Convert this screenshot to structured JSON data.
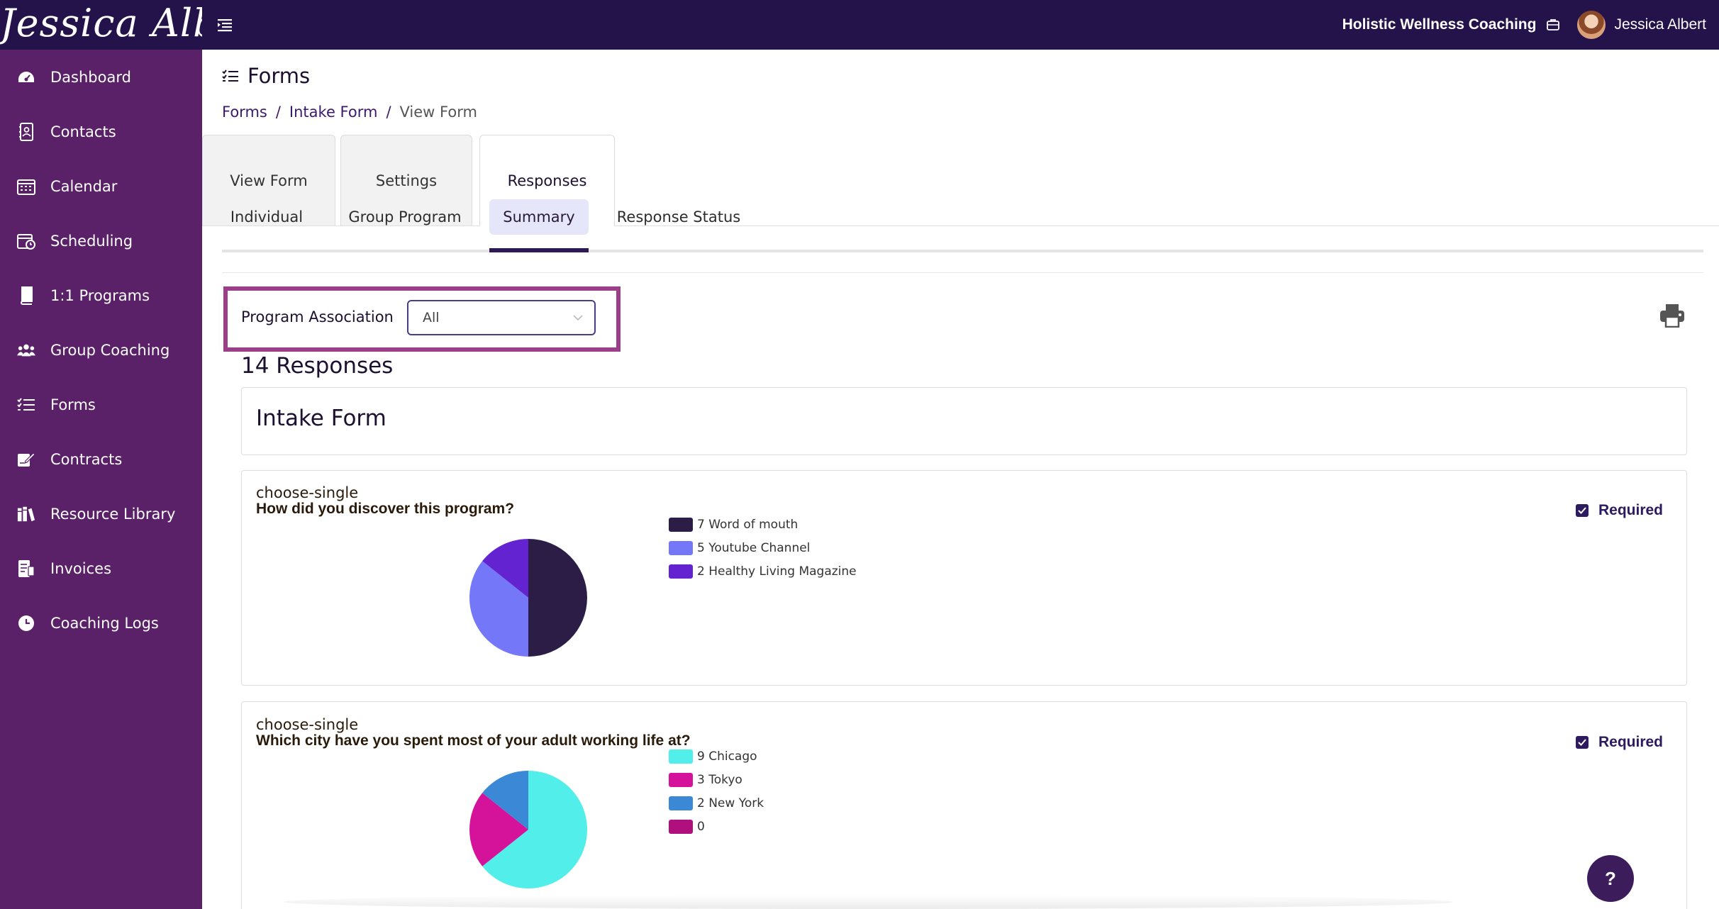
{
  "topbar": {
    "logo_text": "Jessica Albert",
    "business_name": "Holistic Wellness Coaching",
    "user_name": "Jessica Albert"
  },
  "sidebar": {
    "items": [
      {
        "label": "Dashboard",
        "icon": "dashboard-icon"
      },
      {
        "label": "Contacts",
        "icon": "contacts-icon"
      },
      {
        "label": "Calendar",
        "icon": "calendar-icon"
      },
      {
        "label": "Scheduling",
        "icon": "scheduling-icon"
      },
      {
        "label": "1:1 Programs",
        "icon": "book-icon"
      },
      {
        "label": "Group Coaching",
        "icon": "group-icon"
      },
      {
        "label": "Forms",
        "icon": "forms-icon"
      },
      {
        "label": "Contracts",
        "icon": "contract-icon"
      },
      {
        "label": "Resource Library",
        "icon": "library-icon"
      },
      {
        "label": "Invoices",
        "icon": "invoice-icon"
      },
      {
        "label": "Coaching Logs",
        "icon": "clock-icon"
      }
    ]
  },
  "page": {
    "title": "Forms",
    "breadcrumb": [
      "Forms",
      "Intake Form",
      "View Form"
    ],
    "tabs": [
      "View Form",
      "Settings",
      "Responses"
    ],
    "active_tab": "Responses",
    "subtabs": [
      "Individual",
      "Group Program",
      "Summary",
      "Response Status"
    ],
    "active_subtab": "Summary",
    "filter_label": "Program Association",
    "filter_value": "All",
    "responses_count": "14 Responses",
    "form_title": "Intake Form"
  },
  "questions": [
    {
      "type": "choose-single",
      "text": "How did you discover this program?",
      "required_label": "Required",
      "legend": [
        {
          "label": "7 Word of mouth",
          "color": "#2b1d45"
        },
        {
          "label": "5 Youtube Channel",
          "color": "#7478f8"
        },
        {
          "label": "2 Healthy Living Magazine",
          "color": "#6423d0"
        }
      ]
    },
    {
      "type": "choose-single",
      "text": "Which city have you spent most of your adult working life at?",
      "required_label": "Required",
      "legend": [
        {
          "label": "9 Chicago",
          "color": "#52eeea"
        },
        {
          "label": "3 Tokyo",
          "color": "#d4139a"
        },
        {
          "label": "2 New York",
          "color": "#3a88d6"
        },
        {
          "label": "0",
          "color": "#b0107e"
        }
      ]
    }
  ],
  "chart_data": [
    {
      "type": "pie",
      "categories": [
        "Word of mouth",
        "Youtube Channel",
        "Healthy Living Magazine"
      ],
      "values": [
        7,
        5,
        2
      ],
      "colors": [
        "#2b1d45",
        "#7478f8",
        "#6423d0"
      ]
    },
    {
      "type": "pie",
      "categories": [
        "Chicago",
        "Tokyo",
        "New York",
        ""
      ],
      "values": [
        9,
        3,
        2,
        0
      ],
      "colors": [
        "#52eeea",
        "#d4139a",
        "#3a88d6",
        "#b0107e"
      ]
    }
  ],
  "help": {
    "label": "?"
  }
}
